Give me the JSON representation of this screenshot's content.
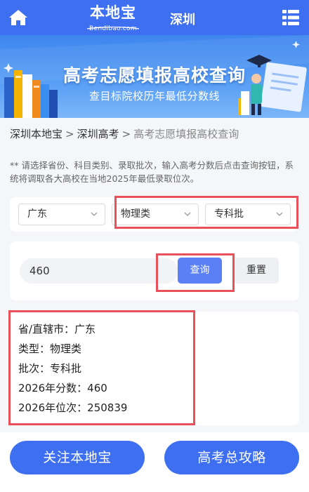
{
  "header": {
    "logo_cn": "本地宝",
    "logo_en": "Bendibao.com",
    "city": "深圳"
  },
  "banner": {
    "title": "高考志愿填报高校查询",
    "subtitle": "查目标院校历年最低分数线"
  },
  "breadcrumb": {
    "items": [
      "深圳本地宝",
      "深圳高考"
    ],
    "separator": ">",
    "current": "高考志愿填报高校查询"
  },
  "notice": "** 请选择省份、科目类别、录取批次，输入高考分数后点击查询按钮，系统将调取各大高校在当地2025年最低录取位次。",
  "filters": {
    "province": "广东",
    "subject": "物理类",
    "batch": "专科批"
  },
  "query": {
    "score_value": "460",
    "query_label": "查询",
    "reset_label": "重置"
  },
  "result": {
    "province_line": "省/直辖市：广东",
    "type_line": "类型：物理类",
    "batch_line": "批次：专科批",
    "score_line": "2026年分数：460",
    "rank_line": "2026年位次：250839"
  },
  "footer": {
    "follow_label": "关注本地宝",
    "guide_label": "高考总攻略"
  },
  "colors": {
    "primary": "#3d6ff0",
    "button": "#5b80f6",
    "highlight": "#e9515a"
  }
}
